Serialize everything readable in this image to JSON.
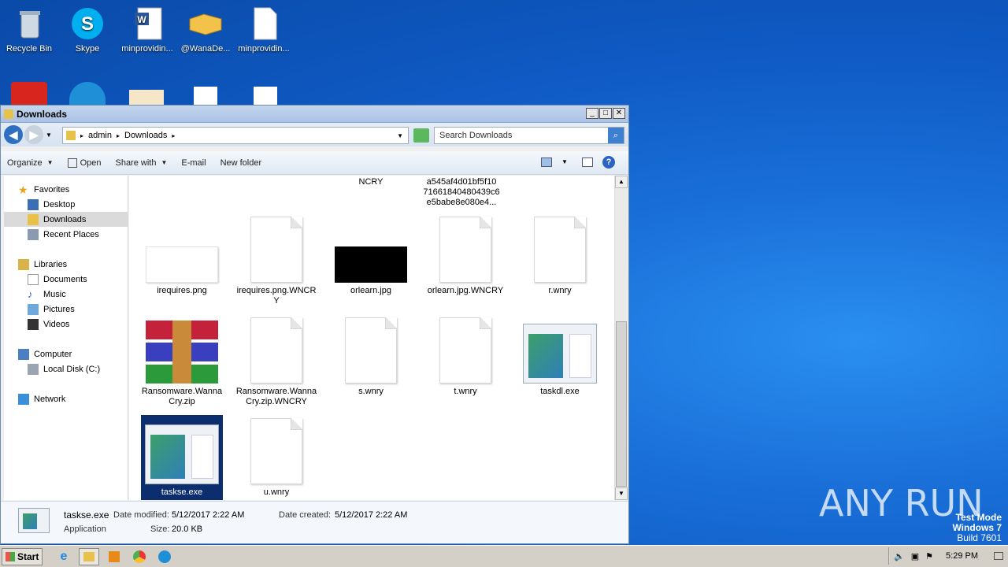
{
  "desktop": {
    "icons": [
      {
        "label": "Recycle Bin"
      },
      {
        "label": "Skype"
      },
      {
        "label": "minprovidin..."
      },
      {
        "label": "@WanaDe..."
      },
      {
        "label": "minprovidin..."
      }
    ]
  },
  "window": {
    "title": "Downloads",
    "address": {
      "seg1": "admin",
      "seg2": "Downloads"
    },
    "search_placeholder": "Search Downloads",
    "toolbar": {
      "organize": "Organize",
      "open": "Open",
      "share_with": "Share with",
      "email": "E-mail",
      "new_folder": "New folder"
    },
    "nav": {
      "favorites": "Favorites",
      "desktop": "Desktop",
      "downloads": "Downloads",
      "recent": "Recent Places",
      "libraries": "Libraries",
      "documents": "Documents",
      "music": "Music",
      "pictures": "Pictures",
      "videos": "Videos",
      "computer": "Computer",
      "local_disk": "Local Disk (C:)",
      "network": "Network"
    },
    "partial_top": {
      "a": "NCRY",
      "b": "a545af4d01bf5f10 71661840480439c6 e5babe8e080e4..."
    },
    "files": [
      {
        "name": "irequires.png"
      },
      {
        "name": "irequires.png.WNCRY"
      },
      {
        "name": "orlearn.jpg"
      },
      {
        "name": "orlearn.jpg.WNCRY"
      },
      {
        "name": "r.wnry"
      },
      {
        "name": "Ransomware.WannaCry.zip"
      },
      {
        "name": "Ransomware.WannaCry.zip.WNCRY"
      },
      {
        "name": "s.wnry"
      },
      {
        "name": "t.wnry"
      },
      {
        "name": "taskdl.exe"
      },
      {
        "name": "taskse.exe"
      },
      {
        "name": "u.wnry"
      }
    ],
    "details": {
      "filename": "taskse.exe",
      "type": "Application",
      "modified_label": "Date modified:",
      "modified": "5/12/2017 2:22 AM",
      "created_label": "Date created:",
      "created": "5/12/2017 2:22 AM",
      "size_label": "Size:",
      "size": "20.0 KB"
    }
  },
  "taskbar": {
    "start": "Start",
    "clock": "5:29 PM"
  },
  "watermark": {
    "line1": "Test Mode",
    "line2": "Windows 7",
    "line3": "Build 7601",
    "brand": "ANY RUN"
  }
}
